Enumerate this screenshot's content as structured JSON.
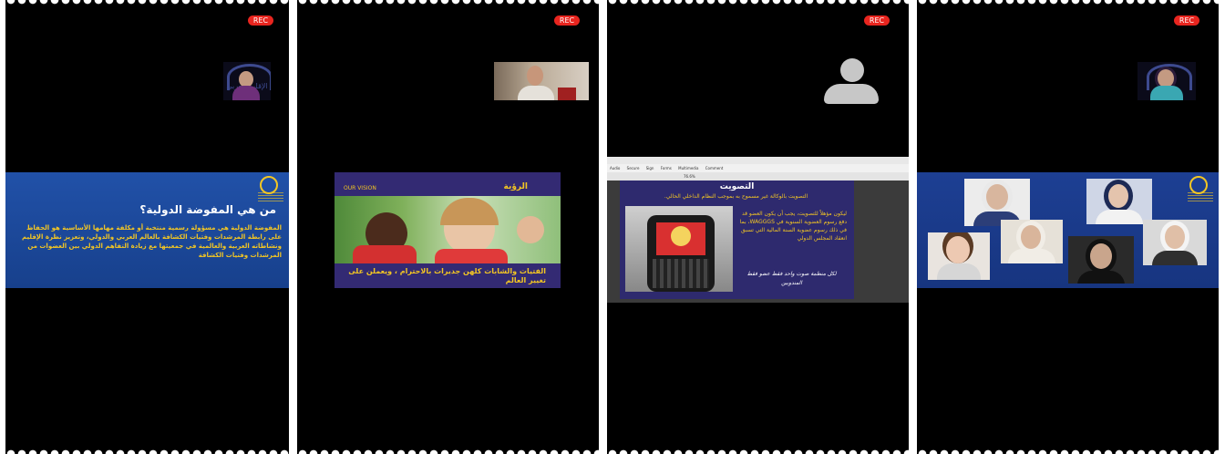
{
  "recording_badge": "REC",
  "tiles": [
    {
      "logo_text": "الإقليم العربي",
      "slide": {
        "heading": "من هي المفوضة الدولية؟",
        "body": "المفوضة الدولية هي مسؤولة رسمية منتخبة أو مكلفة مهامها الأساسية هو الحفاظ على رابطة المرشدات وفتيات الكشافة بالعالم العربي والدولي، وتعزيز نظرة الإقليم ونشاطاته العربية والعالمية في جمعيتها مع زيادة التفاهم الدولي بين العضوات من المرشدات وفتيات الكشافة"
      }
    },
    {
      "slide": {
        "label_en": "OUR VISION",
        "title_ar": "الرؤية",
        "caption": "الفتيات والشابات كلهن جديرات بالاحترام ، ويعملن على تغيير العالم"
      }
    },
    {
      "avatar_icon": "person-icon",
      "toolbar_items": [
        "Audio",
        "Secure",
        "Sign",
        "Forms",
        "Multimedia",
        "Comment"
      ],
      "zoom": "76.6%",
      "slide": {
        "title": "التصويت",
        "subtitle": "التصويت بالوكالة غير مسموح به بموجب النظام الداخلي الحالي.",
        "body": "ليكون مؤهلاً للتصويت، يجب أن يكون العضو قد دفع رسوم العضوية السنوية في WAGGGS، بما في ذلك رسوم عضوية السنة المالية التي تسبق انعقاد المجلس الدولي",
        "footnote": "لكل منظمة صوت واحد فقط عضو فقط المندوبين"
      }
    },
    {
      "photo_count": 7
    }
  ]
}
